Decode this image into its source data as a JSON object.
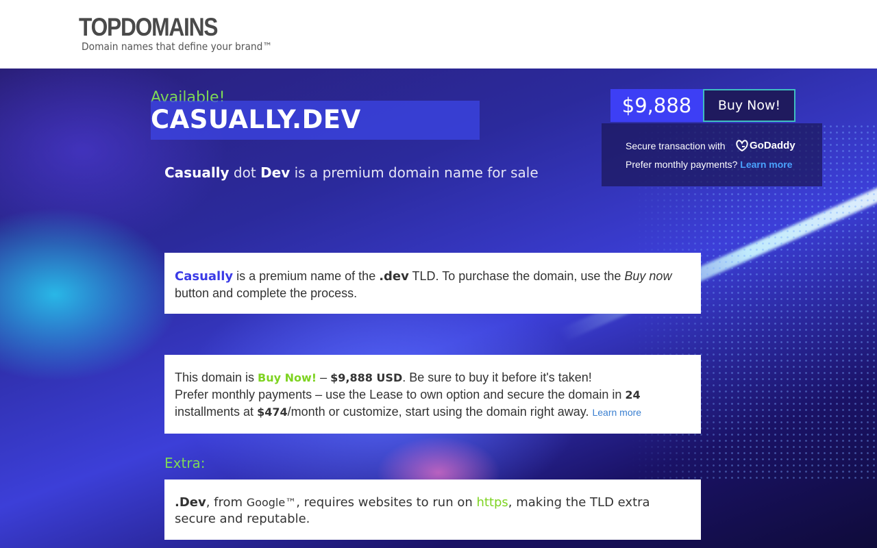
{
  "header": {
    "logo": "TOPDOMAINS",
    "tagline": "Domain names that define your brand™"
  },
  "hero": {
    "available": "Available!",
    "domain": "CASUALLY.DEV",
    "subtitle_name": "Casually",
    "subtitle_dot": " dot ",
    "subtitle_tld": "Dev",
    "subtitle_rest": " is a premium domain name for sale"
  },
  "buy_panel": {
    "price": "$9,888",
    "buy_label": "Buy Now!",
    "secure_text": "Secure transaction with",
    "provider_logo": "GoDaddy",
    "monthly_text": "Prefer monthly payments?",
    "learn_more": "Learn more"
  },
  "card1": {
    "name": "Casually",
    "t1": " is a premium name of the ",
    "tld": ".dev",
    "t2": " TLD. To purchase the domain, use the ",
    "em": "Buy now",
    "t3": " button and complete the process."
  },
  "card2": {
    "t1": "This domain is ",
    "status": "Buy Now!",
    "t2": " – ",
    "price": "$9,888 USD",
    "t3": ". Be sure to buy it before it's taken!",
    "t4": "Prefer monthly payments – use the Lease to own option and secure the domain in ",
    "months": "24",
    "t5": " installments at ",
    "monthly_price": "$474",
    "t6": "/month or customize, start using the domain right away. ",
    "learn_more": "Learn more"
  },
  "extra": {
    "label": "Extra:",
    "tld": ".Dev",
    "t1": ", from ",
    "google": "Google™",
    "t2": ", requires websites to run on ",
    "https": "https",
    "t3": ", making the TLD extra secure and reputable."
  },
  "colors": {
    "accent_green": "#7ed957",
    "accent_blue": "#3d3ff5",
    "link_blue": "#4aa3ff"
  }
}
